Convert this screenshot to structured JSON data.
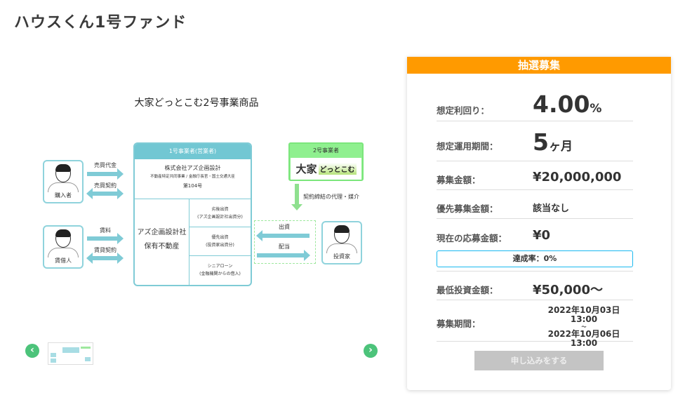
{
  "page_title": "ハウスくん1号ファンド",
  "diagram": {
    "title": "大家どっとこむ2号事業商品",
    "buyer": "購入者",
    "tenant": "賃借人",
    "investor": "投資家",
    "arrow_sale_price": "売買代金",
    "arrow_sale_contract": "売買契約",
    "arrow_rent": "賃料",
    "arrow_lease_contract": "賃貸契約",
    "operator1_header": "1号事業者(営業者)",
    "operator1_company": "株式会社アズ企画設計",
    "operator1_license": "不動産特定共同事業 / 金融庁長官・国土交通大臣",
    "operator1_number": "第104号",
    "property_line1": "アズ企画設計社",
    "property_line2": "保有不動産",
    "sub_investment": "劣後出資",
    "sub_investment_note": "(アズ企画設計社出資分)",
    "priority_investment": "優先出資",
    "priority_investment_note": "(投資家出資分)",
    "senior_loan": "シニアローン",
    "senior_loan_note": "(金融機関からの借入)",
    "operator2_header": "2号事業者",
    "operator2_logo": "大家",
    "operator2_logo_sub": "どっとこむ",
    "agency": "契約締結の代理・媒介",
    "arrow_invest": "出資",
    "arrow_dividend": "配当"
  },
  "card": {
    "header": "抽選募集",
    "yield_label": "想定利回り：",
    "yield_value": "4.00",
    "yield_unit": "%",
    "term_label": "想定運用期間：",
    "term_value": "5",
    "term_unit": "ヶ月",
    "amount_label": "募集金額：",
    "amount_value": "¥20,000,000",
    "priority_label": "優先募集金額：",
    "priority_value": "該当なし",
    "current_label": "現在の応募金額：",
    "current_value": "¥0",
    "rate_text": "達成率：0%",
    "rate_percent": 0,
    "min_label": "最低投資金額：",
    "min_value": "¥50,000〜",
    "period_label": "募集期間：",
    "period_start": "2022年10月03日 13:00",
    "period_sep": "〜",
    "period_end": "2022年10月06日 13:00",
    "apply_button": "申し込みをする"
  },
  "colors": {
    "accent": "#ff9a00",
    "teal": "#72c7d3",
    "green": "#4cc37a",
    "progress_border": "#1ab9f0"
  }
}
